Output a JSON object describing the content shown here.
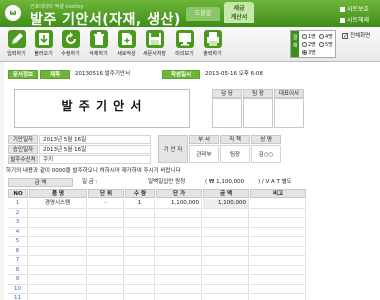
{
  "header": {
    "logo": "ω",
    "subtitle": "인포데이타 엑셀 cooltey",
    "title": "발주 기안서(자재, 생산)",
    "tab_help": "도움말",
    "tab_calc": "세금\n계산서",
    "link_protect": "시트보호",
    "link_unprotect": "시트해제"
  },
  "toolbar": {
    "items": [
      {
        "label": "입력하기",
        "icon": "pencil-icon"
      },
      {
        "label": "불러오기",
        "icon": "download-icon"
      },
      {
        "label": "수정하기",
        "icon": "refresh-icon"
      },
      {
        "label": "삭제하기",
        "icon": "trash-icon"
      },
      {
        "label": "새로작성",
        "icon": "new-doc-icon"
      },
      {
        "label": "새문서저장",
        "icon": "save-icon"
      },
      {
        "label": "미리보기",
        "icon": "monitor-icon"
      },
      {
        "label": "출력하기",
        "icon": "print-icon"
      }
    ],
    "radio_label": "결재",
    "radio_options": [
      "1명",
      "2명",
      "3명",
      "4명",
      "5명"
    ],
    "radio_selected": "3명",
    "fullscreen_label": "전체화면"
  },
  "doc": {
    "info_label": "문서정보",
    "subject_label": "제목",
    "subject_value": "20130516 발주기안서",
    "date_label": "작성일시",
    "date_value": "2013-05-16  오후 6:08",
    "title": "발 주 기 안 서",
    "approval_headers": [
      "담 당",
      "팀 장",
      "대표이사"
    ],
    "draft_date_label": "기안일자",
    "draft_date_value": "2013년 5월 16일",
    "approve_date_label": "승인일자",
    "approve_date_value": "2013년 5월 16일",
    "recipient_label": "발주수신처",
    "recipient_value": "쿠키",
    "drafter_label": "기 안 자",
    "drafter_headers": [
      "부 서",
      "직 책",
      "성 명"
    ],
    "drafter_values": [
      "관리부",
      "팀장",
      "김○○"
    ],
    "notice": "하기의 내용과 같이 0000을 발주하오니 허하시어 재가하여 주시기 바랍니다",
    "amount_label": "금 액",
    "amount_text": "일 금 :",
    "amount_korean": "일백일십만 원정",
    "amount_value": "( ₩        1,100,000",
    "amount_vat": ") / V A T 별도",
    "table_headers": [
      "NO",
      "품 명",
      "단 위",
      "수 량",
      "단 가",
      "금 액",
      "비고"
    ],
    "rows": [
      {
        "no": "1",
        "name": "경영시스템",
        "unit": "-",
        "qty": "1",
        "price": "1,100,000",
        "amount": "1,100,000",
        "note": ""
      },
      {
        "no": "2"
      },
      {
        "no": "3"
      },
      {
        "no": "4"
      },
      {
        "no": "5"
      },
      {
        "no": "6"
      },
      {
        "no": "7"
      },
      {
        "no": "8"
      },
      {
        "no": "9"
      },
      {
        "no": "10"
      },
      {
        "no": "11"
      }
    ]
  }
}
